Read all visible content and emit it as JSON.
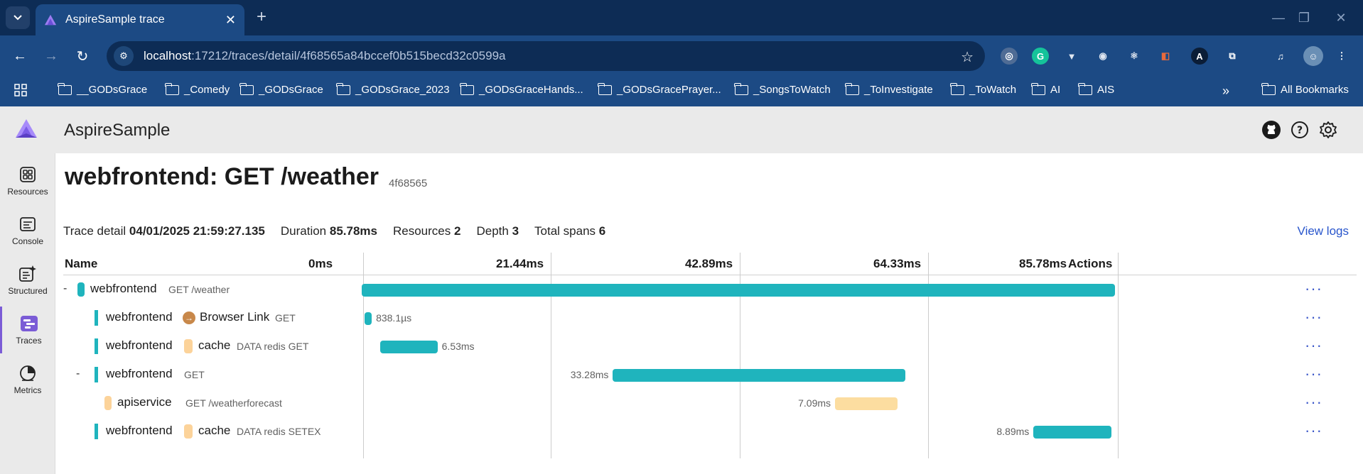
{
  "browser": {
    "tab_title": "AspireSample trace",
    "url_host": "localhost",
    "url_path": ":17212/traces/detail/4f68565a84bccef0b515becd32c0599a",
    "bookmarks": [
      "__GODsGrace",
      "_Comedy",
      "_GODsGrace",
      "_GODsGrace_2023",
      "_GODsGraceHands...",
      "_GODsGracePrayer...",
      "_SongsToWatch",
      "_ToInvestigate",
      "_ToWatch",
      "AI",
      "AIS"
    ],
    "all_bookmarks": "All Bookmarks",
    "overflow": "»"
  },
  "app": {
    "name": "AspireSample"
  },
  "sidenav": [
    {
      "label": "Resources",
      "icon": "resources-icon"
    },
    {
      "label": "Console",
      "icon": "console-icon"
    },
    {
      "label": "Structured",
      "icon": "structured-icon"
    },
    {
      "label": "Traces",
      "icon": "traces-icon",
      "active": true
    },
    {
      "label": "Metrics",
      "icon": "metrics-icon"
    }
  ],
  "page": {
    "title": "webfrontend: GET /weather",
    "trace_id": "4f68565",
    "summary": {
      "trace_detail_label": "Trace detail",
      "trace_detail_value": "04/01/2025 21:59:27.135",
      "duration_label": "Duration",
      "duration_value": "85.78ms",
      "resources_label": "Resources",
      "resources_value": "2",
      "depth_label": "Depth",
      "depth_value": "3",
      "total_spans_label": "Total spans",
      "total_spans_value": "6"
    },
    "view_logs": "View logs"
  },
  "grid": {
    "headers": {
      "name": "Name",
      "t0": "0ms",
      "t1": "21.44ms",
      "t2": "42.89ms",
      "t3": "64.33ms",
      "t4": "85.78ms",
      "actions": "Actions"
    },
    "total_duration_ms": 85.78,
    "rows": [
      {
        "collapse": "-",
        "service": "webfrontend",
        "peer": "",
        "operation": "GET /weather",
        "start_ms": 0,
        "duration_ms": 85.78,
        "duration_label": "",
        "color": "#1fb4bd",
        "icon_color": "#1fb4bd",
        "actions": "···"
      },
      {
        "collapse": "",
        "service": "webfrontend",
        "peer": "Browser Link",
        "operation": "GET",
        "start_ms": 0.3,
        "duration_ms": 0.84,
        "duration_label": "838.1µs",
        "color": "#1fb4bd",
        "icon_color": "#c8884a",
        "actions": "···"
      },
      {
        "collapse": "",
        "service": "webfrontend",
        "peer": "cache",
        "operation": "DATA redis GET",
        "start_ms": 2.1,
        "duration_ms": 6.53,
        "duration_label": "6.53ms",
        "color": "#1fb4bd",
        "icon_color": "#fcd39a",
        "actions": "···"
      },
      {
        "collapse": "-",
        "service": "webfrontend",
        "peer": "",
        "operation": "GET",
        "start_ms": 28.6,
        "duration_ms": 33.28,
        "duration_label": "33.28ms",
        "color": "#1fb4bd",
        "icon_color": "",
        "actions": "···"
      },
      {
        "collapse": "",
        "service": "apiservice",
        "peer": "",
        "operation": "GET /weatherforecast",
        "start_ms": 53.9,
        "duration_ms": 7.09,
        "duration_label": "7.09ms",
        "color": "#fcdda0",
        "icon_color": "#fcd39a",
        "actions": "···"
      },
      {
        "collapse": "",
        "service": "webfrontend",
        "peer": "cache",
        "operation": "DATA redis SETEX",
        "start_ms": 76.5,
        "duration_ms": 8.89,
        "duration_label": "8.89ms",
        "color": "#1fb4bd",
        "icon_color": "#fcd39a",
        "actions": "···"
      }
    ]
  }
}
